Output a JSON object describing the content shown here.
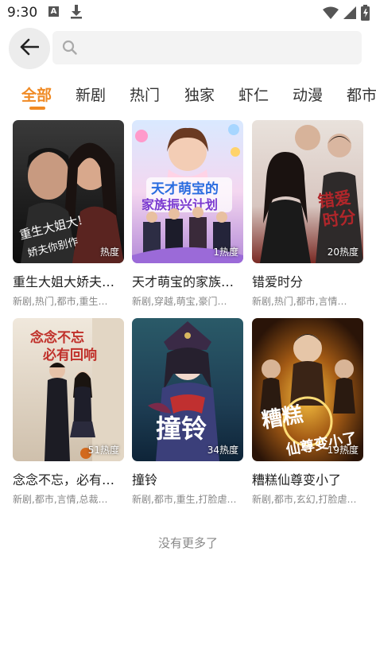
{
  "status": {
    "time": "9:30"
  },
  "search": {
    "placeholder": ""
  },
  "tabs": [
    {
      "label": "全部"
    },
    {
      "label": "新剧"
    },
    {
      "label": "热门"
    },
    {
      "label": "独家"
    },
    {
      "label": "虾仁"
    },
    {
      "label": "动漫"
    },
    {
      "label": "都市"
    }
  ],
  "cards": [
    {
      "title": "重生大姐大娇夫…",
      "tags": "新剧,热门,都市,重生…",
      "heat": "热度",
      "poster_text": "重生大姐大!娇夫你别作"
    },
    {
      "title": "天才萌宝的家族…",
      "tags": "新剧,穿越,萌宝,豪门…",
      "heat": "1热度",
      "poster_text": "天才萌宝的家族振兴计划"
    },
    {
      "title": "错爱时分",
      "tags": "新剧,热门,都市,言情…",
      "heat": "20热度",
      "poster_text": "错爱时分"
    },
    {
      "title": "念念不忘，必有…",
      "tags": "新剧,都市,言情,总裁…",
      "heat": "51热度",
      "poster_text": "念念不忘必有回响"
    },
    {
      "title": "撞铃",
      "tags": "新剧,都市,重生,打脸虐…",
      "heat": "34热度",
      "poster_text": "撞铃"
    },
    {
      "title": "糟糕仙尊变小了",
      "tags": "新剧,都市,玄幻,打脸虐…",
      "heat": "19热度",
      "poster_text": "糟糕仙尊变小了"
    }
  ],
  "footer": {
    "text": "没有更多了"
  }
}
